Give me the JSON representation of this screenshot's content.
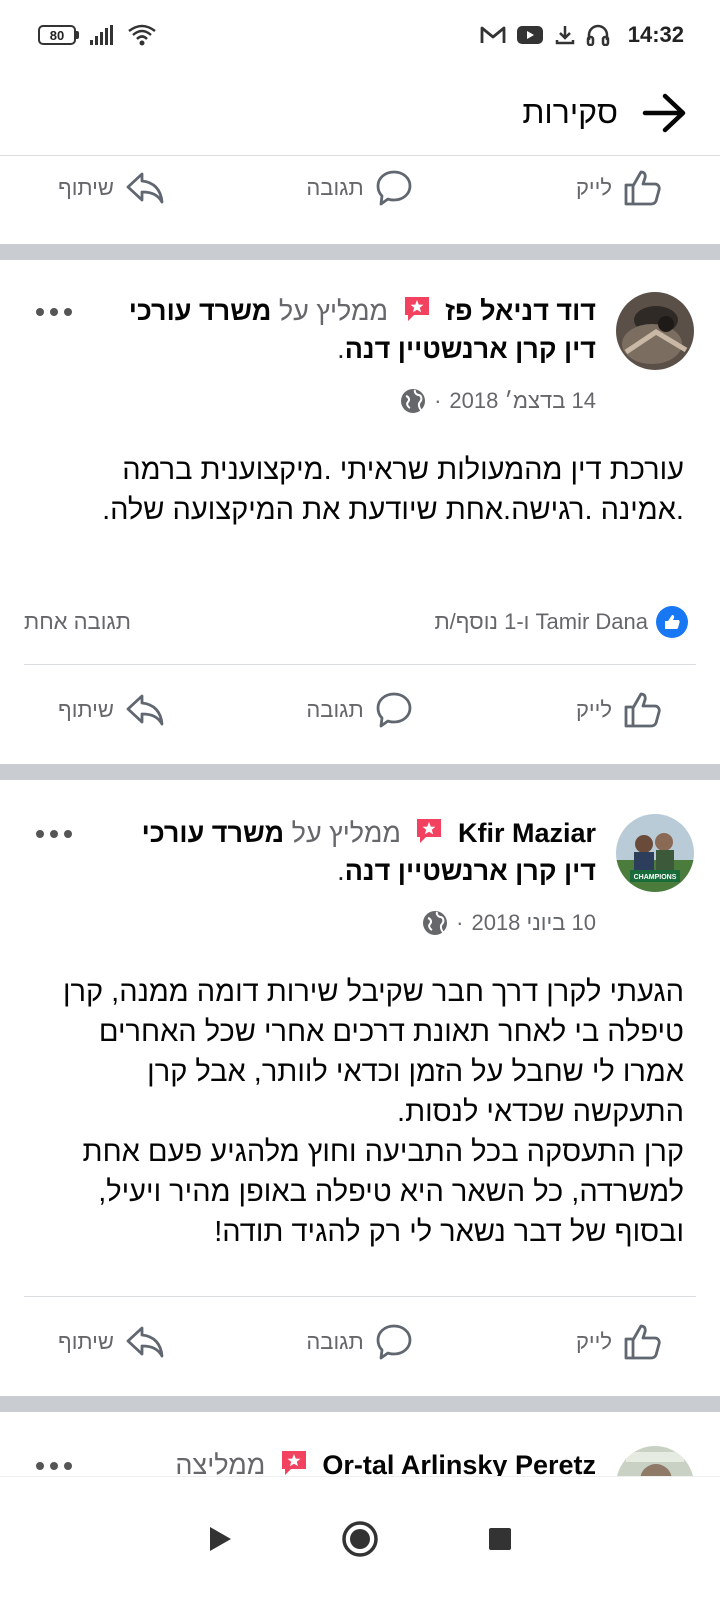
{
  "status_bar": {
    "battery": "80",
    "time": "14:32",
    "icons": [
      "battery-icon",
      "signal-icon",
      "wifi-icon",
      "gmail-icon",
      "youtube-icon",
      "download-icon",
      "headphones-icon"
    ]
  },
  "header": {
    "title": "סקירות",
    "back_icon": "arrow-right-icon"
  },
  "actions": {
    "like": "לייק",
    "comment": "תגובה",
    "share": "שיתוף"
  },
  "reviews": [
    {
      "author": "דוד דניאל פז",
      "recommends": "ממליץ על",
      "page": "משרד עורכי דין קרן ארנשטיין דנה",
      "date": "14 בדצמ׳ 2018",
      "text": "עורכת דין מהמעולות שראיתי .מיקצוענית ברמה .אמינה .רגישה.אחת שיודעת את המיקצועה שלה.",
      "reactions_text": "Tamir Dana ו-1 נוסף/ת",
      "comments_count": "תגובה אחת"
    },
    {
      "author": "Kfir Maziar",
      "recommends": "ממליץ על",
      "page": "משרד עורכי דין קרן ארנשטיין דנה",
      "date": "10 ביוני 2018",
      "avatar_text": "CHAMPIONS",
      "text": "הגעתי לקרן דרך חבר שקיבל שירות דומה ממנה, קרן טיפלה בי לאחר תאונת דרכים אחרי שכל האחרים אמרו לי שחבל על הזמן וכדאי לוותר, אבל קרן התעקשה שכדאי לנסות.\nקרן התעסקה בכל התביעה וחוץ מלהגיע פעם אחת למשרדה, כל השאר היא טיפלה באופן מהיר ויעיל, ובסוף של דבר נשאר לי רק להגיד תודה!"
    },
    {
      "author": "Or-tal Arlinsky Peretz",
      "recommends": "ממליצה"
    }
  ],
  "colors": {
    "accent": "#1877f2",
    "secondary_text": "#65676b",
    "separator": "#c9ccd1",
    "badge": "#f3425f"
  },
  "nav_bar": [
    "back-triangle-icon",
    "home-circle-icon",
    "recents-square-icon"
  ]
}
